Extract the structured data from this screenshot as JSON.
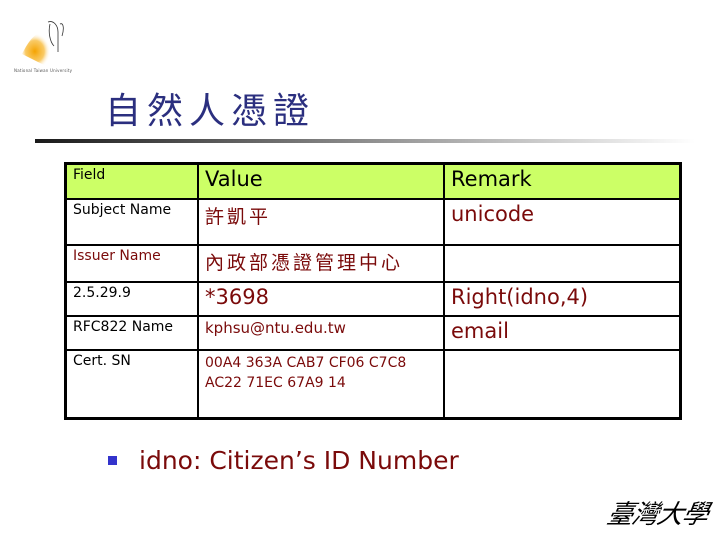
{
  "logo": {
    "caption": "National Taiwan University",
    "icon": "ntu-emblem-icon"
  },
  "title": "自然人憑證",
  "table": {
    "headers": [
      "Field",
      "Value",
      "Remark"
    ],
    "rows": [
      {
        "field": "Subject Name",
        "value": "許凱平",
        "remark": "unicode"
      },
      {
        "field": "Issuer Name",
        "value": "內政部憑證管理中心",
        "remark": ""
      },
      {
        "field": "2.5.29.9",
        "value": "*3698",
        "remark": "Right(idno,4)"
      },
      {
        "field": "RFC822 Name",
        "value": "kphsu@ntu.edu.tw",
        "remark": "email"
      },
      {
        "field": "Cert. SN",
        "value_lines": [
          "00A4 363A CAB7 CF06 C7C8",
          "AC22 71EC 67A9 14"
        ],
        "remark": ""
      }
    ]
  },
  "bullet": {
    "text": "idno: Citizen’s ID Number"
  },
  "footer_logo": {
    "text": "臺灣大學"
  },
  "colors": {
    "title": "#2b2f7f",
    "header_bg": "#ccff66",
    "value_text": "#7a0a0a",
    "bullet": "#3333cc"
  }
}
